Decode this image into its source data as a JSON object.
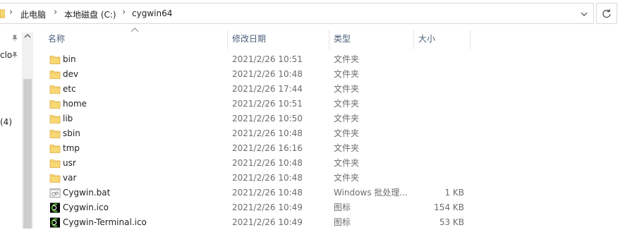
{
  "breadcrumb": {
    "items": [
      "此电脑",
      "本地磁盘 (C:)",
      "cygwin64"
    ],
    "separator": "›"
  },
  "navpane": {
    "fragments": [
      "clo",
      "(4)"
    ]
  },
  "columns": {
    "name": "名称",
    "date": "修改日期",
    "type": "类型",
    "size": "大小"
  },
  "sort": {
    "column": "name",
    "direction": "ascending"
  },
  "files": [
    {
      "name": "bin",
      "date": "2021/2/26 10:51",
      "type": "文件夹",
      "size": "",
      "icon": "folder-icon"
    },
    {
      "name": "dev",
      "date": "2021/2/26 10:48",
      "type": "文件夹",
      "size": "",
      "icon": "folder-icon"
    },
    {
      "name": "etc",
      "date": "2021/2/26 17:44",
      "type": "文件夹",
      "size": "",
      "icon": "folder-icon"
    },
    {
      "name": "home",
      "date": "2021/2/26 10:51",
      "type": "文件夹",
      "size": "",
      "icon": "folder-icon"
    },
    {
      "name": "lib",
      "date": "2021/2/26 10:50",
      "type": "文件夹",
      "size": "",
      "icon": "folder-icon"
    },
    {
      "name": "sbin",
      "date": "2021/2/26 10:48",
      "type": "文件夹",
      "size": "",
      "icon": "folder-icon"
    },
    {
      "name": "tmp",
      "date": "2021/2/26 16:16",
      "type": "文件夹",
      "size": "",
      "icon": "folder-icon"
    },
    {
      "name": "usr",
      "date": "2021/2/26 10:48",
      "type": "文件夹",
      "size": "",
      "icon": "folder-icon"
    },
    {
      "name": "var",
      "date": "2021/2/26 10:48",
      "type": "文件夹",
      "size": "",
      "icon": "folder-icon"
    },
    {
      "name": "Cygwin.bat",
      "date": "2021/2/26 10:48",
      "type": "Windows 批处理...",
      "size": "1 KB",
      "icon": "batch-file-icon"
    },
    {
      "name": "Cygwin.ico",
      "date": "2021/2/26 10:49",
      "type": "图标",
      "size": "154 KB",
      "icon": "cygwin-icon"
    },
    {
      "name": "Cygwin-Terminal.ico",
      "date": "2021/2/26 10:49",
      "type": "图标",
      "size": "53 KB",
      "icon": "cygwin-icon"
    }
  ],
  "colors": {
    "folder": "#f8d775",
    "folder_dark": "#e8b84a",
    "header_text": "#4c607a",
    "secondary_text": "#6d6d6d",
    "cygwin_green": "#4fa82a"
  }
}
